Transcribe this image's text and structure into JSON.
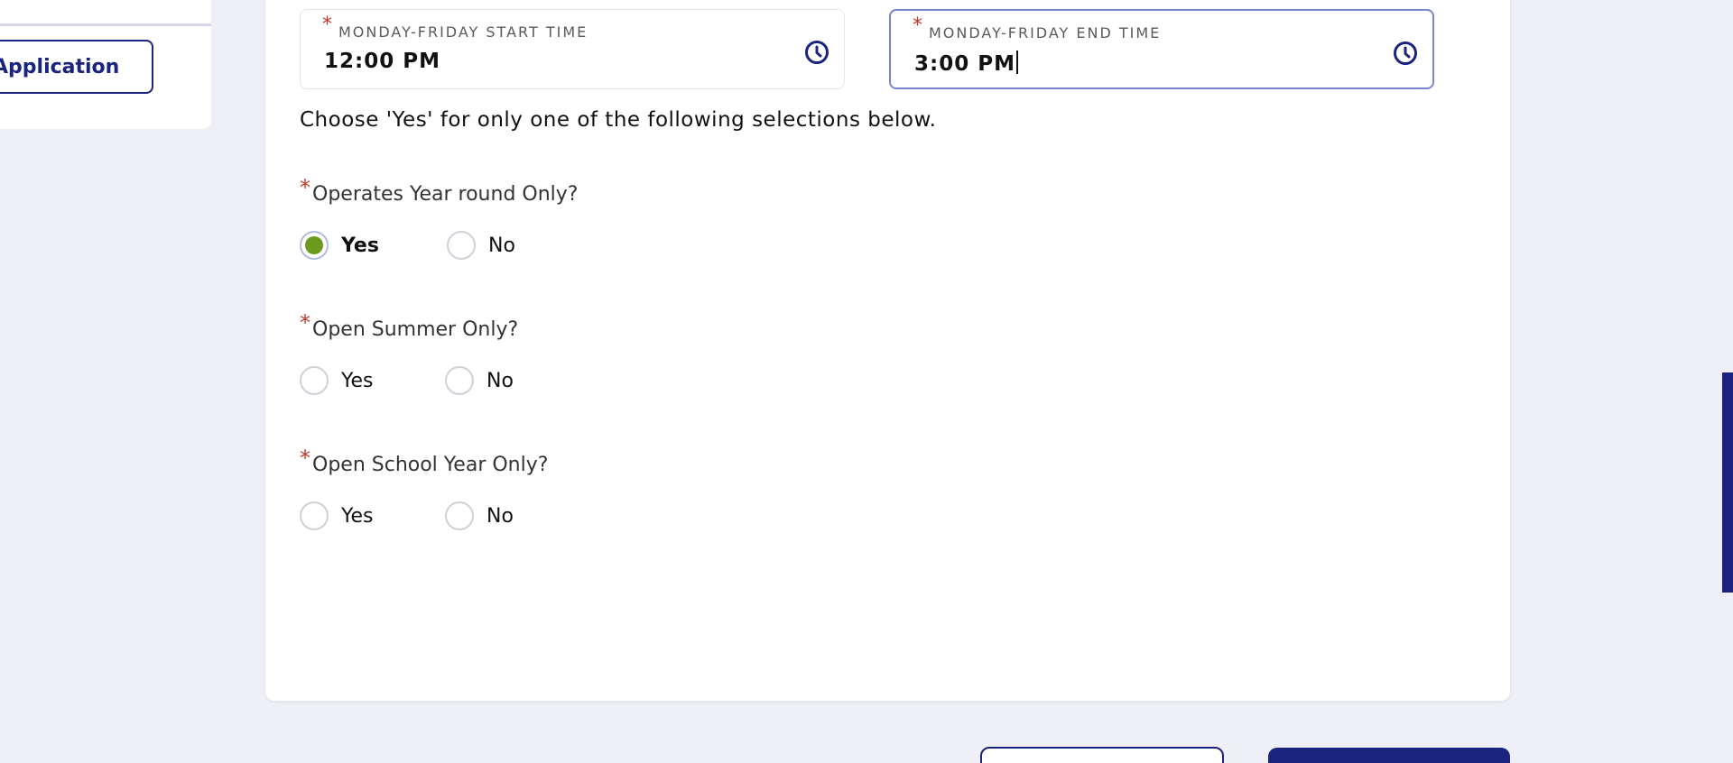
{
  "sidebar": {
    "button_label": "Application"
  },
  "hours": {
    "start": {
      "label": "MONDAY-FRIDAY START TIME",
      "value": "12:00 PM",
      "required_mark": "*",
      "icon": "clock-icon"
    },
    "end": {
      "label": "MONDAY-FRIDAY END TIME",
      "value": "3:00 PM",
      "required_mark": "*",
      "icon": "clock-icon",
      "focused": true
    }
  },
  "instruction": "Choose 'Yes' for only one of the following selections below.",
  "questions": [
    {
      "label": "Operates Year round Only?",
      "required_mark": "*",
      "options": [
        "Yes",
        "No"
      ],
      "selected": "Yes"
    },
    {
      "label": "Open Summer Only?",
      "required_mark": "*",
      "options": [
        "Yes",
        "No"
      ],
      "selected": null
    },
    {
      "label": "Open School Year Only?",
      "required_mark": "*",
      "options": [
        "Yes",
        "No"
      ],
      "selected": null
    }
  ],
  "colors": {
    "primary": "#1a237e",
    "required": "#c0392b",
    "radio_selected": "#6b9a1f",
    "page_background": "#efeff8"
  }
}
